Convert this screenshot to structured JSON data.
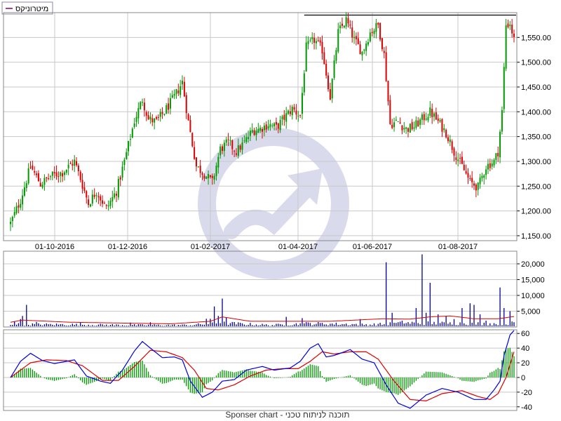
{
  "legend": {
    "label": "מיטרוניקס"
  },
  "footer": {
    "text": "Sponser chart - תוכנה לניתוח טכני"
  },
  "colors": {
    "up": "#009900",
    "down": "#dd0000",
    "volume": "#000099",
    "volume_avg": "#dd0000",
    "macd": "#0000dd",
    "signal": "#dd0000",
    "hist": "#009900",
    "grid": "#c8c8c8",
    "frame": "#888888",
    "watermark": "#d6d6ec",
    "resistance": "#000000"
  },
  "chart_data": [
    {
      "type": "candlestick",
      "panel": "price",
      "x_tick_labels": [
        "01-10-2016",
        "01-12-2016",
        "01-02-2017",
        "01-04-2017",
        "01-06-2017",
        "01-08-2017"
      ],
      "y_tick_labels": [
        "1,150.00",
        "1,200.00",
        "1,250.00",
        "1,300.00",
        "1,350.00",
        "1,400.00",
        "1,450.00",
        "1,500.00",
        "1,550.00"
      ],
      "ylim": [
        1140,
        1600
      ],
      "resistance_level": 1595,
      "anchors": [
        [
          0,
          1175
        ],
        [
          5,
          1222
        ],
        [
          10,
          1290
        ],
        [
          15,
          1254
        ],
        [
          20,
          1270
        ],
        [
          26,
          1278
        ],
        [
          32,
          1300
        ],
        [
          35,
          1265
        ],
        [
          39,
          1215
        ],
        [
          43,
          1240
        ],
        [
          48,
          1205
        ],
        [
          53,
          1240
        ],
        [
          57,
          1300
        ],
        [
          62,
          1382
        ],
        [
          66,
          1425
        ],
        [
          69,
          1385
        ],
        [
          73,
          1380
        ],
        [
          77,
          1400
        ],
        [
          82,
          1430
        ],
        [
          86,
          1460
        ],
        [
          89,
          1380
        ],
        [
          93,
          1290
        ],
        [
          97,
          1275
        ],
        [
          101,
          1258
        ],
        [
          105,
          1325
        ],
        [
          109,
          1338
        ],
        [
          113,
          1320
        ],
        [
          117,
          1338
        ],
        [
          121,
          1362
        ],
        [
          125,
          1366
        ],
        [
          129,
          1375
        ],
        [
          133,
          1368
        ],
        [
          137,
          1388
        ],
        [
          141,
          1406
        ],
        [
          145,
          1392
        ],
        [
          148,
          1530
        ],
        [
          152,
          1545
        ],
        [
          156,
          1525
        ],
        [
          160,
          1430
        ],
        [
          164,
          1560
        ],
        [
          168,
          1585
        ],
        [
          172,
          1545
        ],
        [
          176,
          1520
        ],
        [
          180,
          1560
        ],
        [
          184,
          1575
        ],
        [
          187,
          1515
        ],
        [
          190,
          1375
        ],
        [
          194,
          1380
        ],
        [
          198,
          1365
        ],
        [
          202,
          1370
        ],
        [
          206,
          1385
        ],
        [
          210,
          1400
        ],
        [
          214,
          1380
        ],
        [
          218,
          1358
        ],
        [
          222,
          1320
        ],
        [
          226,
          1290
        ],
        [
          230,
          1258
        ],
        [
          234,
          1248
        ],
        [
          238,
          1290
        ],
        [
          242,
          1300
        ],
        [
          244,
          1320
        ],
        [
          246,
          1400
        ],
        [
          248,
          1575
        ],
        [
          250,
          1578
        ],
        [
          252,
          1545
        ]
      ],
      "ohlc": []
    },
    {
      "type": "bar",
      "panel": "volume",
      "y_tick_labels": [
        "5,000",
        "10,000",
        "15,000",
        "20,000"
      ],
      "ylim": [
        0,
        24000
      ],
      "base": [
        [
          0,
          1000
        ],
        [
          30,
          900
        ],
        [
          60,
          700
        ],
        [
          90,
          700
        ],
        [
          105,
          1500
        ],
        [
          130,
          700
        ],
        [
          150,
          1300
        ],
        [
          180,
          900
        ],
        [
          200,
          1500
        ],
        [
          240,
          1200
        ],
        [
          252,
          1500
        ]
      ],
      "spikes": [
        [
          2,
          1800
        ],
        [
          5,
          2500
        ],
        [
          6,
          3500
        ],
        [
          8,
          7000
        ],
        [
          13,
          1600
        ],
        [
          35,
          1400
        ],
        [
          60,
          1400
        ],
        [
          70,
          1500
        ],
        [
          98,
          2600
        ],
        [
          100,
          2600
        ],
        [
          102,
          6500
        ],
        [
          104,
          3500
        ],
        [
          106,
          9000
        ],
        [
          108,
          3000
        ],
        [
          138,
          3200
        ],
        [
          146,
          2800
        ],
        [
          175,
          2500
        ],
        [
          188,
          20500
        ],
        [
          191,
          4500
        ],
        [
          196,
          2000
        ],
        [
          203,
          6000
        ],
        [
          206,
          23000
        ],
        [
          208,
          4500
        ],
        [
          210,
          14000
        ],
        [
          214,
          4000
        ],
        [
          218,
          3500
        ],
        [
          222,
          2500
        ],
        [
          226,
          6000
        ],
        [
          230,
          7500
        ],
        [
          232,
          7000
        ],
        [
          235,
          4000
        ],
        [
          238,
          2000
        ],
        [
          245,
          12500
        ],
        [
          247,
          6000
        ],
        [
          250,
          5000
        ]
      ],
      "average_anchors": [
        [
          0,
          1500
        ],
        [
          6,
          2200
        ],
        [
          12,
          2000
        ],
        [
          30,
          1500
        ],
        [
          80,
          1000
        ],
        [
          100,
          1800
        ],
        [
          106,
          3200
        ],
        [
          120,
          1800
        ],
        [
          160,
          1800
        ],
        [
          186,
          2600
        ],
        [
          200,
          2500
        ],
        [
          210,
          3200
        ],
        [
          220,
          3500
        ],
        [
          232,
          2600
        ],
        [
          244,
          2600
        ],
        [
          252,
          3300
        ]
      ],
      "values": []
    },
    {
      "type": "line",
      "panel": "macd",
      "y_tick_labels": [
        "-40",
        "-20",
        "0",
        "20",
        "40",
        "60"
      ],
      "ylim": [
        -45,
        65
      ],
      "macd_anchors": [
        [
          0,
          0
        ],
        [
          5,
          22
        ],
        [
          10,
          33
        ],
        [
          16,
          23
        ],
        [
          22,
          19
        ],
        [
          32,
          24
        ],
        [
          38,
          2
        ],
        [
          45,
          -5
        ],
        [
          50,
          -8
        ],
        [
          56,
          10
        ],
        [
          62,
          36
        ],
        [
          66,
          49
        ],
        [
          70,
          40
        ],
        [
          76,
          27
        ],
        [
          82,
          28
        ],
        [
          86,
          24
        ],
        [
          90,
          -5
        ],
        [
          96,
          -27
        ],
        [
          101,
          -20
        ],
        [
          106,
          -5
        ],
        [
          112,
          -3
        ],
        [
          118,
          10
        ],
        [
          126,
          15
        ],
        [
          132,
          10
        ],
        [
          140,
          13
        ],
        [
          145,
          22
        ],
        [
          150,
          40
        ],
        [
          154,
          46
        ],
        [
          158,
          28
        ],
        [
          162,
          30
        ],
        [
          170,
          38
        ],
        [
          176,
          25
        ],
        [
          182,
          20
        ],
        [
          188,
          -10
        ],
        [
          194,
          -35
        ],
        [
          200,
          -42
        ],
        [
          208,
          -24
        ],
        [
          216,
          -15
        ],
        [
          224,
          -20
        ],
        [
          232,
          -30
        ],
        [
          238,
          -30
        ],
        [
          242,
          -17
        ],
        [
          245,
          -5
        ],
        [
          247,
          30
        ],
        [
          250,
          58
        ],
        [
          252,
          64
        ]
      ],
      "signal_anchors": [
        [
          0,
          0
        ],
        [
          10,
          20
        ],
        [
          18,
          24
        ],
        [
          28,
          23
        ],
        [
          36,
          16
        ],
        [
          46,
          -4
        ],
        [
          54,
          -4
        ],
        [
          62,
          15
        ],
        [
          70,
          37
        ],
        [
          78,
          35
        ],
        [
          86,
          27
        ],
        [
          92,
          10
        ],
        [
          98,
          -15
        ],
        [
          104,
          -17
        ],
        [
          112,
          -10
        ],
        [
          120,
          2
        ],
        [
          128,
          10
        ],
        [
          136,
          12
        ],
        [
          144,
          12
        ],
        [
          150,
          22
        ],
        [
          156,
          35
        ],
        [
          162,
          32
        ],
        [
          170,
          35
        ],
        [
          178,
          35
        ],
        [
          184,
          25
        ],
        [
          192,
          -5
        ],
        [
          200,
          -30
        ],
        [
          208,
          -32
        ],
        [
          216,
          -22
        ],
        [
          226,
          -18
        ],
        [
          234,
          -26
        ],
        [
          240,
          -30
        ],
        [
          244,
          -22
        ],
        [
          248,
          0
        ],
        [
          252,
          35
        ]
      ]
    }
  ]
}
